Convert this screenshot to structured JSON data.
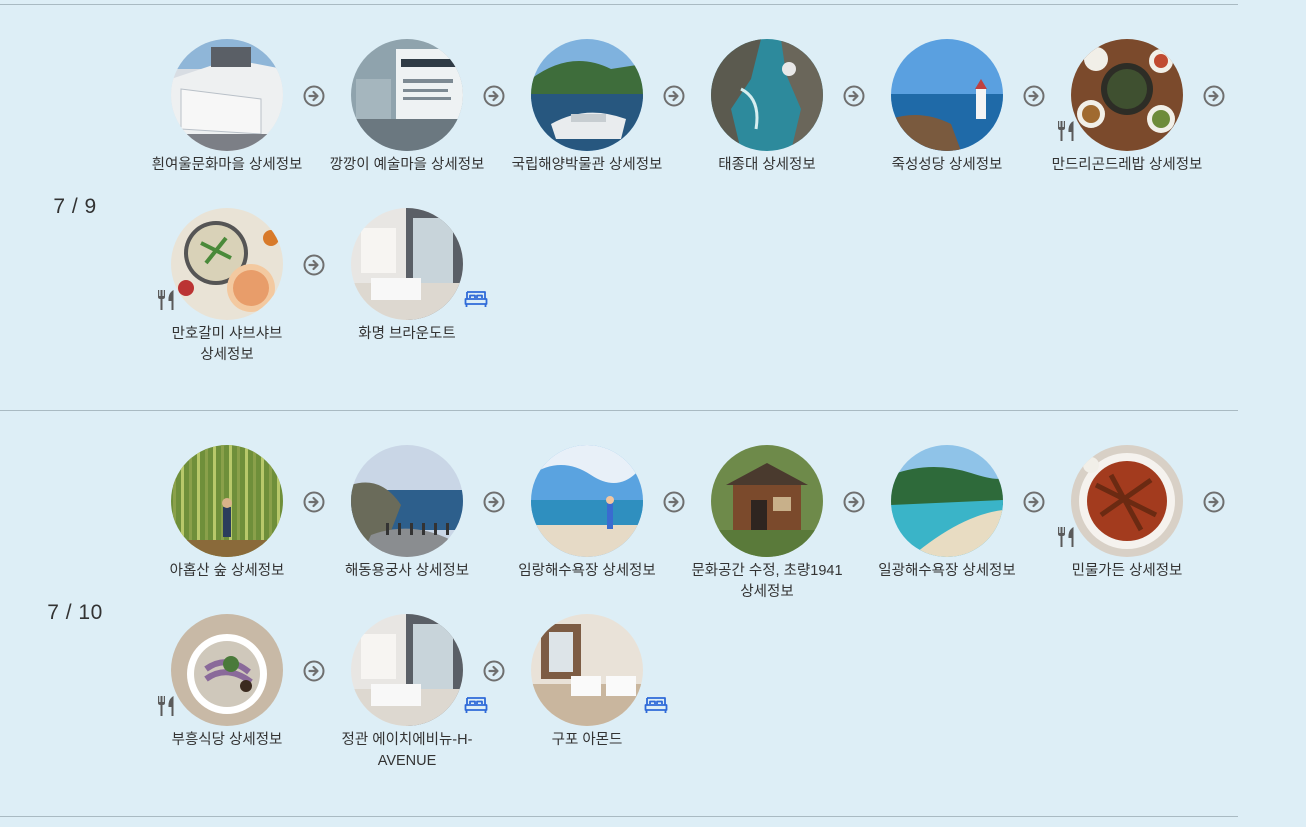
{
  "colors": {
    "background": "#ddeef6",
    "divider": "#a9bac2",
    "arrow": "#6f6f6f",
    "food_badge": "#5a5a5a",
    "hotel_badge": "#2f6ad8"
  },
  "days": [
    {
      "date_label": "7 / 9",
      "rows": [
        [
          {
            "label": "흰여울문화마을 상세정보",
            "type": "spot",
            "icon": "walled-village-photo"
          },
          {
            "label": "깡깡이 예술마을 상세정보",
            "type": "spot",
            "icon": "art-village-sign-photo"
          },
          {
            "label": "국립해양박물관 상세정보",
            "type": "spot",
            "icon": "maritime-museum-photo"
          },
          {
            "label": "태종대 상세정보",
            "type": "spot",
            "icon": "coastal-cliff-photo"
          },
          {
            "label": "죽성성당 상세정보",
            "type": "spot",
            "icon": "seaside-church-photo"
          },
          {
            "label": "만드리곤드레밥 상세정보",
            "type": "food",
            "icon": "korean-table-photo"
          }
        ],
        [
          {
            "label": "만호갈미 샤브샤브 상세정보",
            "type": "food",
            "icon": "shabu-shabu-photo"
          },
          {
            "label": "화명 브라운도트",
            "type": "hotel",
            "icon": "hotel-room-photo"
          }
        ]
      ]
    },
    {
      "date_label": "7 / 10",
      "rows": [
        [
          {
            "label": "아홉산 숲 상세정보",
            "type": "spot",
            "icon": "bamboo-forest-photo"
          },
          {
            "label": "해동용궁사 상세정보",
            "type": "spot",
            "icon": "seaside-temple-photo"
          },
          {
            "label": "임랑해수욕장 상세정보",
            "type": "spot",
            "icon": "beach-person-photo"
          },
          {
            "label": "문화공간 수정, 초량1941 상세정보",
            "type": "spot",
            "icon": "old-house-photo"
          },
          {
            "label": "일광해수욕장 상세정보",
            "type": "spot",
            "icon": "bay-beach-photo"
          },
          {
            "label": "민물가든 상세정보",
            "type": "food",
            "icon": "braised-fish-photo"
          }
        ],
        [
          {
            "label": "부흥식당 상세정보",
            "type": "food",
            "icon": "noodle-bowl-photo"
          },
          {
            "label": "정관 에이치에비뉴-H-AVENUE",
            "type": "hotel",
            "icon": "hotel-room-photo"
          },
          {
            "label": "구포 아몬드",
            "type": "hotel",
            "icon": "twin-bed-room-photo"
          }
        ]
      ]
    }
  ]
}
